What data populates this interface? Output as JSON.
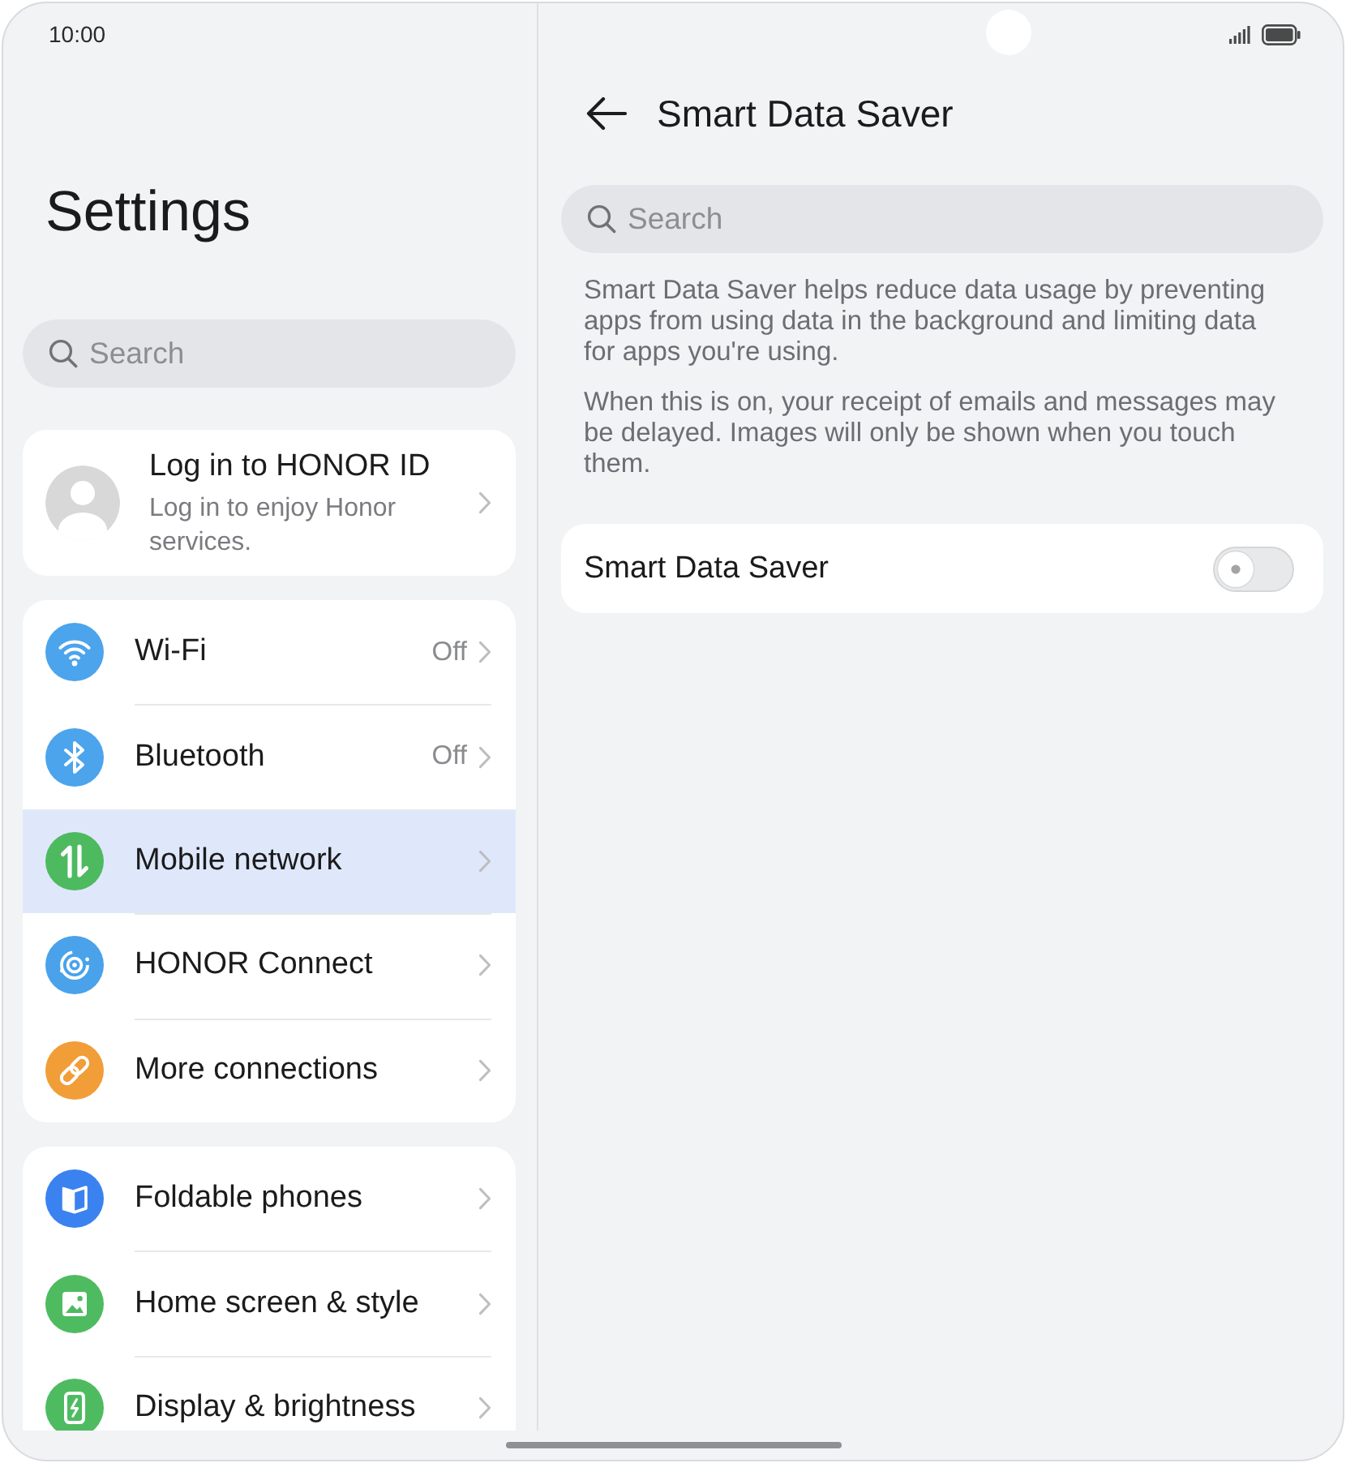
{
  "status_bar": {
    "time": "10:00"
  },
  "settings": {
    "title": "Settings",
    "search": {
      "placeholder": "Search"
    },
    "account": {
      "title": "Log in to HONOR ID",
      "subtitle": "Log in to enjoy Honor services."
    },
    "groups": [
      {
        "items": [
          {
            "label": "Wi-Fi",
            "value": "Off",
            "color": "#4ba4ec",
            "selected": false
          },
          {
            "label": "Bluetooth",
            "value": "Off",
            "color": "#4ba4ec",
            "selected": false
          },
          {
            "label": "Mobile network",
            "color": "#4dba5f",
            "selected": true
          },
          {
            "label": "HONOR Connect",
            "color": "#49a2ea",
            "selected": false
          },
          {
            "label": "More connections",
            "color": "#f19d38",
            "selected": false
          }
        ]
      },
      {
        "items": [
          {
            "label": "Foldable phones",
            "color": "#3b82f1",
            "selected": false
          },
          {
            "label": "Home screen & style",
            "color": "#4fbb61",
            "selected": false
          },
          {
            "label": "Display & brightness",
            "color": "#4fbb61",
            "selected": false
          }
        ]
      }
    ]
  },
  "detail": {
    "title": "Smart Data Saver",
    "search": {
      "placeholder": "Search"
    },
    "paragraphs": [
      "Smart Data Saver helps reduce data usage by preventing apps from using data in the background and limiting data for apps you're using.",
      "When this is on, your receipt of emails and messages may be delayed. Images will only be shown when you touch them."
    ],
    "toggle": {
      "label": "Smart Data Saver",
      "on": false
    }
  }
}
